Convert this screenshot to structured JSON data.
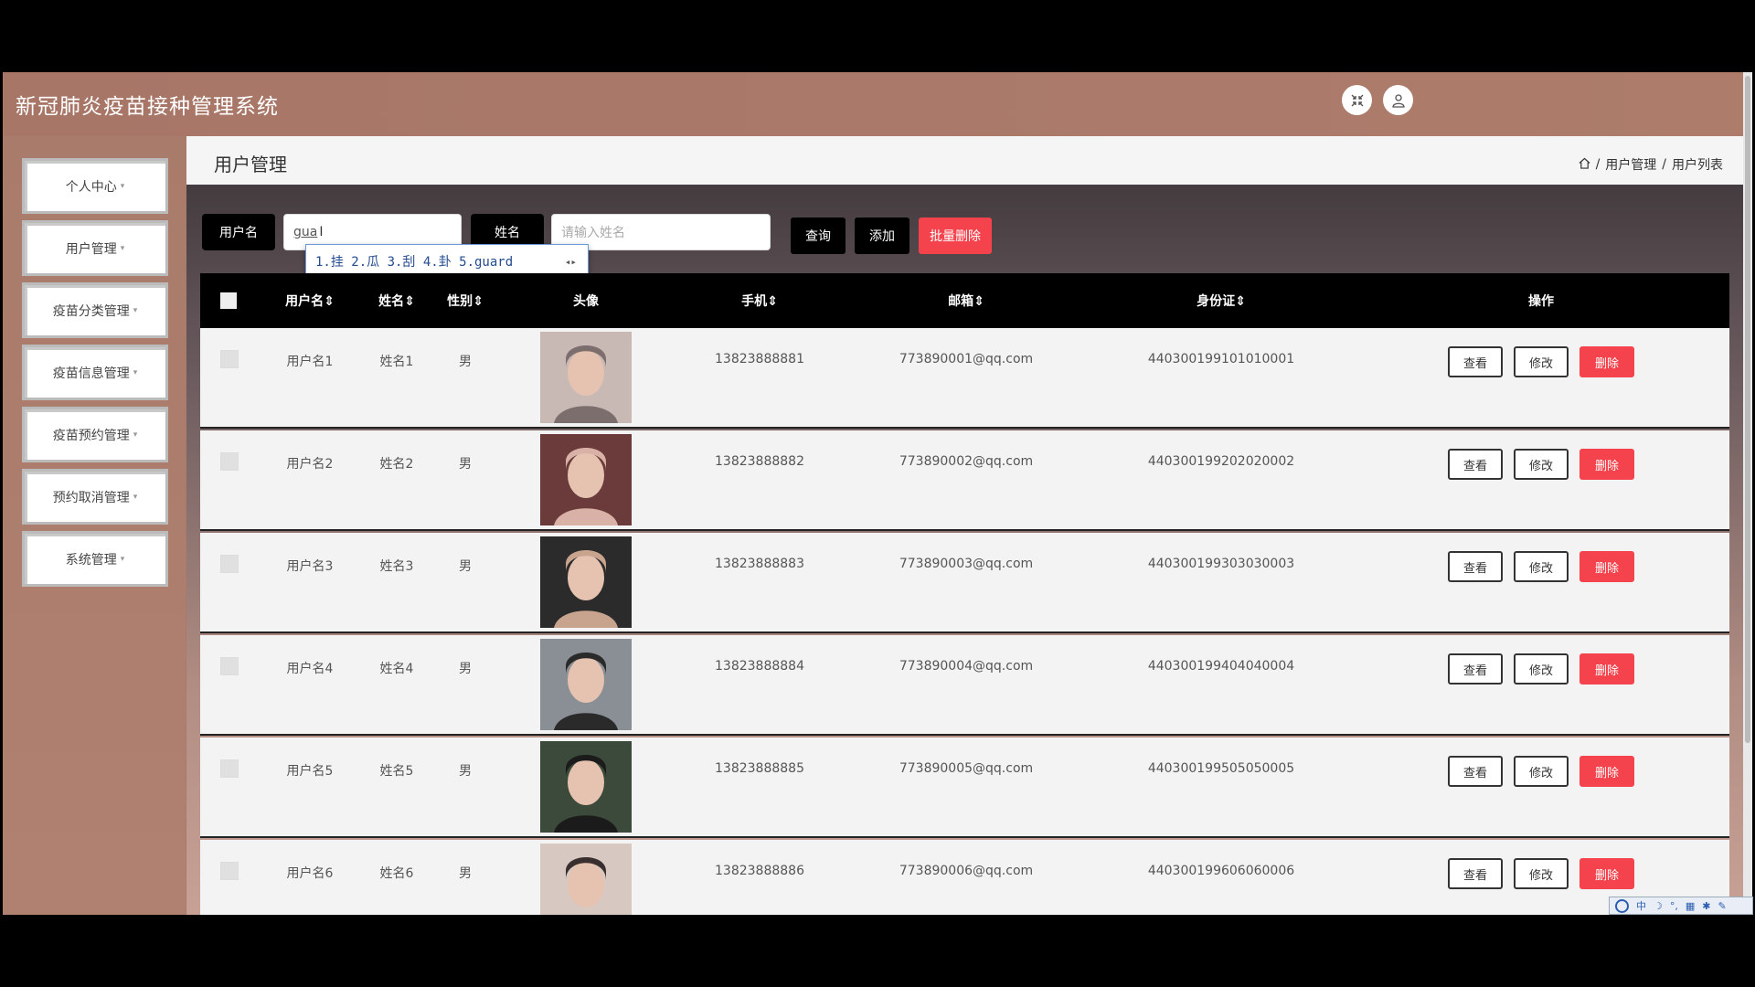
{
  "app": {
    "title": "新冠肺炎疫苗接种管理系统"
  },
  "header": {
    "fullscreen_icon": "fullscreen-exit-icon",
    "user_icon": "user-icon"
  },
  "sidebar": {
    "items": [
      {
        "label": "个人中心"
      },
      {
        "label": "用户管理"
      },
      {
        "label": "疫苗分类管理"
      },
      {
        "label": "疫苗信息管理"
      },
      {
        "label": "疫苗预约管理"
      },
      {
        "label": "预约取消管理"
      },
      {
        "label": "系统管理"
      }
    ]
  },
  "page": {
    "title": "用户管理",
    "breadcrumb": [
      "用户管理",
      "用户列表"
    ],
    "separator": "/"
  },
  "search": {
    "username_label": "用户名",
    "username_value": "gua",
    "name_label": "姓名",
    "name_placeholder": "请输入姓名",
    "query_button": "查询",
    "add_button": "添加",
    "batch_delete_button": "批量删除"
  },
  "ime": {
    "candidates": "1.挂 2.瓜 3.刮 4.卦 5.guard",
    "arrows": "◂▸"
  },
  "table": {
    "columns": [
      "用户名⇕",
      "姓名⇕",
      "性别⇕",
      "头像",
      "手机⇕",
      "邮箱⇕",
      "身份证⇕",
      "操作"
    ],
    "rows": [
      {
        "username": "用户名1",
        "name": "姓名1",
        "gender": "男",
        "phone": "13823888881",
        "email": "773890001@qq.com",
        "id_card": "440300199101010001"
      },
      {
        "username": "用户名2",
        "name": "姓名2",
        "gender": "男",
        "phone": "13823888882",
        "email": "773890002@qq.com",
        "id_card": "440300199202020002"
      },
      {
        "username": "用户名3",
        "name": "姓名3",
        "gender": "男",
        "phone": "13823888883",
        "email": "773890003@qq.com",
        "id_card": "440300199303030003"
      },
      {
        "username": "用户名4",
        "name": "姓名4",
        "gender": "男",
        "phone": "13823888884",
        "email": "773890004@qq.com",
        "id_card": "440300199404040004"
      },
      {
        "username": "用户名5",
        "name": "姓名5",
        "gender": "男",
        "phone": "13823888885",
        "email": "773890005@qq.com",
        "id_card": "440300199505050005"
      },
      {
        "username": "用户名6",
        "name": "姓名6",
        "gender": "男",
        "phone": "13823888886",
        "email": "773890006@qq.com",
        "id_card": "440300199606060006"
      }
    ],
    "view_label": "查看",
    "edit_label": "修改",
    "delete_label": "删除"
  },
  "tray": {
    "text": "中"
  },
  "colors": {
    "accent_red": "#f4434d",
    "brand": "#a97b6b",
    "dark": "#000000"
  }
}
